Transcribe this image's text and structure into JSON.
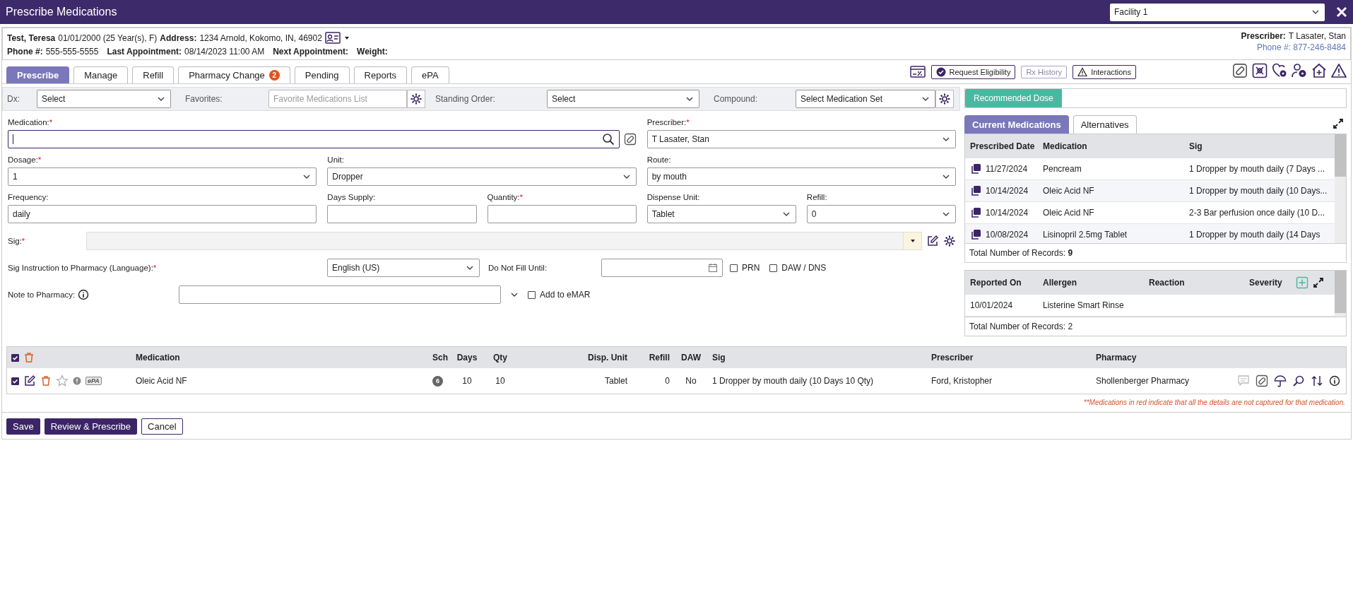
{
  "window": {
    "title": "Prescribe Medications",
    "facility": "Facility 1"
  },
  "patient": {
    "name": "Test, Teresa",
    "details": "01/01/2000 (25 Year(s), F)",
    "address_label": "Address:",
    "address": "1234 Arnold, Kokomo, IN, 46902",
    "phone_label": "Phone #:",
    "phone": "555-555-5555",
    "last_appointment_label": "Last Appointment:",
    "last_appointment": "08/14/2023 11:00 AM",
    "next_appointment_label": "Next Appointment:",
    "weight_label": "Weight:"
  },
  "prescriber_info": {
    "label": "Prescriber:",
    "name": "T Lasater, Stan",
    "phone": "Phone #: 877-246-8484"
  },
  "tabs": [
    {
      "label": "Prescribe",
      "selected": true
    },
    {
      "label": "Manage",
      "selected": false
    },
    {
      "label": "Refill",
      "selected": false
    },
    {
      "label": "Pharmacy Change",
      "selected": false,
      "badge": "2"
    },
    {
      "label": "Pending",
      "selected": false
    },
    {
      "label": "Reports",
      "selected": false
    },
    {
      "label": "ePA",
      "selected": false
    }
  ],
  "toolbar": [
    {
      "label": "Request Eligibility",
      "kind": "check",
      "disabled": false
    },
    {
      "label": "Rx History",
      "kind": "plain",
      "disabled": true
    },
    {
      "label": "Interactions",
      "kind": "warning",
      "disabled": false
    }
  ],
  "filters": [
    {
      "label": "Dx:",
      "kind": "select",
      "value": "Select"
    },
    {
      "label": "Favorites:",
      "kind": "input",
      "placeholder": "Favorite Medications List"
    },
    {
      "label": "Standing Order:",
      "kind": "select",
      "value": "Select"
    },
    {
      "label": "Compound:",
      "kind": "select",
      "value": "Select Medication Set"
    }
  ],
  "form_rows": [
    [
      {
        "label": "Medication:",
        "required_mark": "*",
        "kind": "search"
      },
      {
        "label": "Prescriber:",
        "required_mark": "*",
        "kind": "select",
        "value": "T Lasater, Stan"
      }
    ],
    [
      {
        "label": "Dosage:",
        "required_mark": "*",
        "kind": "select",
        "value": "1"
      },
      {
        "label": "Unit:",
        "kind": "select",
        "value": "Dropper"
      },
      {
        "label": "Route:",
        "kind": "select",
        "value": "by mouth"
      }
    ],
    [
      {
        "label": "Frequency:",
        "kind": "text",
        "value": "daily"
      },
      {
        "label": "Days Supply:",
        "kind": "text"
      },
      {
        "label": "Quantity:",
        "required_mark": "*",
        "kind": "text"
      },
      {
        "label": "Dispense Unit:",
        "kind": "select",
        "value": "Tablet"
      },
      {
        "label": "Refill:",
        "kind": "select",
        "value": "0"
      }
    ]
  ],
  "sig": {
    "label": "Sig:",
    "required_mark": "*"
  },
  "sig_instruction": {
    "label": "Sig Instruction to Pharmacy (Language):",
    "required_mark": "*",
    "value": "English (US)",
    "do_not_fill_label": "Do Not Fill Until:",
    "checkboxes": [
      {
        "label": "PRN",
        "checked": false
      },
      {
        "label": "DAW / DNS",
        "checked": false
      }
    ]
  },
  "note": {
    "label": "Note to Pharmacy:",
    "checkbox": {
      "label": "Add to eMAR",
      "checked": false
    }
  },
  "grid": {
    "all_checked": true,
    "columns": [
      "Medication",
      "Sch",
      "Days",
      "Qty",
      "Disp. Unit",
      "Refill",
      "DAW",
      "Sig",
      "Prescriber",
      "Pharmacy"
    ],
    "rows": [
      {
        "checked": true,
        "favorite": false,
        "epa": "ePA",
        "cells": [
          "Oleic Acid NF",
          "6",
          "10",
          "10",
          "Tablet",
          "0",
          "No",
          "1 Dropper by mouth daily (10 Days 10 Qty)",
          "Ford, Kristopher",
          "Shollenberger Pharmacy"
        ]
      }
    ],
    "note": "**Medications in red indicate that all the details are not captured for that medication."
  },
  "buttons": [
    {
      "label": "Save",
      "kind": "primary"
    },
    {
      "label": "Review & Prescribe",
      "kind": "primary"
    },
    {
      "label": "Cancel",
      "kind": "secondary"
    }
  ],
  "recommended_dose": "Recommended Dose",
  "med_tabs": [
    {
      "label": "Current Medications",
      "selected": true
    },
    {
      "label": "Alternatives",
      "selected": false
    }
  ],
  "current_medications": {
    "columns": [
      "Prescribed Date",
      "Medication",
      "Sig"
    ],
    "rows": [
      [
        "11/27/2024",
        "Pencream",
        "1 Dropper by mouth daily (7 Days ..."
      ],
      [
        "10/14/2024",
        "Oleic Acid NF",
        "1 Dropper by mouth daily (10 Days..."
      ],
      [
        "10/14/2024",
        "Oleic Acid NF",
        "2-3 Bar perfusion once daily (10 D..."
      ],
      [
        "10/08/2024",
        "Lisinopril 2.5mg Tablet",
        "1 Dropper by mouth daily (14 Days"
      ]
    ],
    "total": "Total Number of Records: **9**"
  },
  "allergies": {
    "columns": [
      "Reported On",
      "Allergen",
      "Reaction",
      "Severity"
    ],
    "rows": [
      [
        "10/01/2024",
        "Listerine Smart Rinse"
      ]
    ],
    "total": "Total Number of Records: 2"
  }
}
